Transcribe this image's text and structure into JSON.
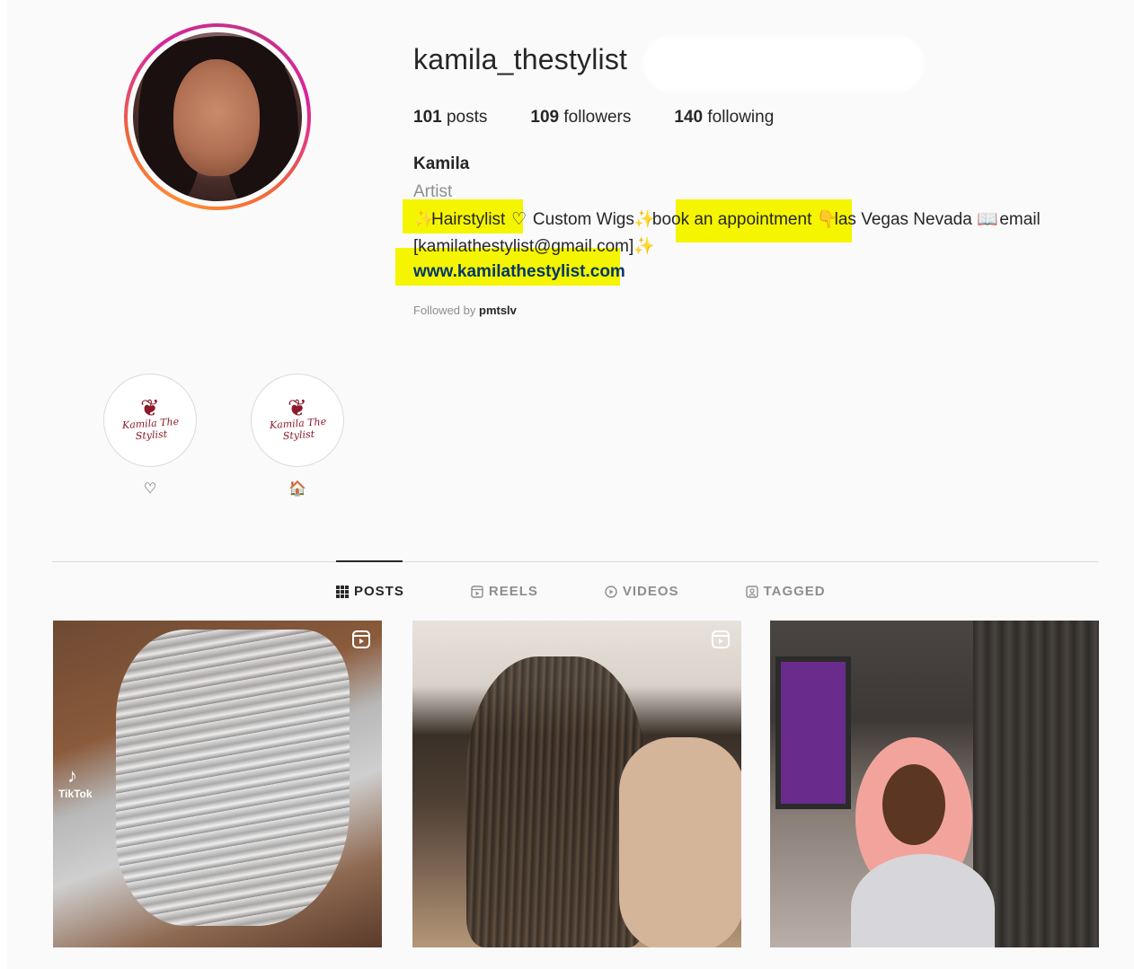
{
  "profile": {
    "username": "kamila_thestylist",
    "stats": {
      "posts_count": "101",
      "posts_label": "posts",
      "followers_count": "109",
      "followers_label": "followers",
      "following_count": "140",
      "following_label": "following"
    },
    "full_name": "Kamila",
    "category": "Artist",
    "bio": {
      "emoji_1": "✨",
      "hairstylist": "Hairstylist",
      "emoji_2": "♡",
      "custom_wigs": "Custom Wigs",
      "emoji_3": "✨",
      "book": "book an appointment",
      "emoji_4": "👇",
      "location": "las Vegas Nevada",
      "emoji_5": "📖",
      "email_word": "email",
      "email": "[kamilathestylist@gmail.com]",
      "emoji_6": "✨",
      "website": "www.kamilathestylist.com"
    },
    "followed_by_prefix": "Followed by",
    "followed_by_user": "pmtslv"
  },
  "highlights": [
    {
      "label": "♡",
      "logo_text": "Kamila The Stylist"
    },
    {
      "label": "🏠",
      "logo_text": "Kamila The Stylist"
    }
  ],
  "tabs": [
    {
      "label": "POSTS",
      "icon": "grid-icon",
      "active": true
    },
    {
      "label": "REELS",
      "icon": "reels-icon",
      "active": false
    },
    {
      "label": "VIDEOS",
      "icon": "play-icon",
      "active": false
    },
    {
      "label": "TAGGED",
      "icon": "tagged-icon",
      "active": false
    }
  ],
  "posts": [
    {
      "type": "reel",
      "overlay_text": "TikTok",
      "icon": "reel-icon"
    },
    {
      "type": "reel",
      "icon": "reel-icon"
    },
    {
      "type": "image"
    }
  ],
  "colors": {
    "highlight_marker": "#f5f500",
    "story_ring": [
      "#fd8d32",
      "#d6249f",
      "#c13584"
    ],
    "link": "#00376b"
  }
}
